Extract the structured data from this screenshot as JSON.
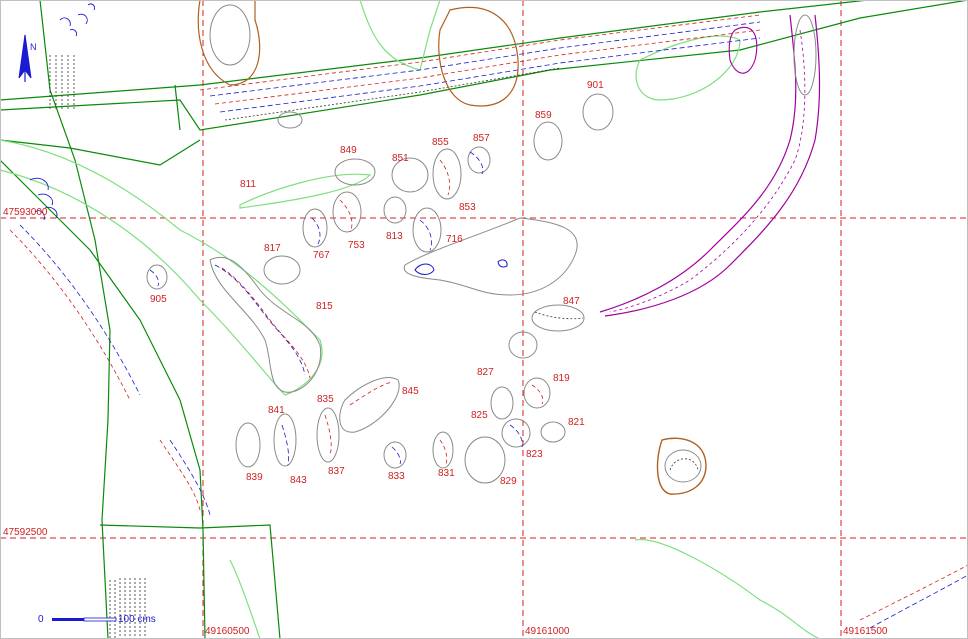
{
  "grid": {
    "x_labels": [
      "49160500",
      "49161000",
      "49161500"
    ],
    "y_labels": [
      "47593000",
      "47592500"
    ]
  },
  "scale_bar": {
    "start_label": "0",
    "end_label": "100 cms"
  },
  "north_arrow": {
    "label": "N",
    "icon": "north-arrow-icon"
  },
  "colors": {
    "grid": "#d42020",
    "feature_outline": "#8a8a8a",
    "trench_dark": "#0a8a0a",
    "trench_light": "#7ee07e",
    "hatching_red": "#d02020",
    "hatching_blue": "#1a1ad0",
    "hatching_purple": "#a000a0",
    "hatching_brown": "#b06020"
  },
  "features": [
    {
      "id": "901"
    },
    {
      "id": "859"
    },
    {
      "id": "857"
    },
    {
      "id": "855"
    },
    {
      "id": "851"
    },
    {
      "id": "849"
    },
    {
      "id": "811"
    },
    {
      "id": "853"
    },
    {
      "id": "813"
    },
    {
      "id": "716"
    },
    {
      "id": "753"
    },
    {
      "id": "767"
    },
    {
      "id": "817"
    },
    {
      "id": "905"
    },
    {
      "id": "815"
    },
    {
      "id": "847"
    },
    {
      "id": "845"
    },
    {
      "id": "835"
    },
    {
      "id": "841"
    },
    {
      "id": "839"
    },
    {
      "id": "843"
    },
    {
      "id": "837"
    },
    {
      "id": "833"
    },
    {
      "id": "831"
    },
    {
      "id": "829"
    },
    {
      "id": "827"
    },
    {
      "id": "825"
    },
    {
      "id": "823"
    },
    {
      "id": "819"
    },
    {
      "id": "821"
    }
  ]
}
